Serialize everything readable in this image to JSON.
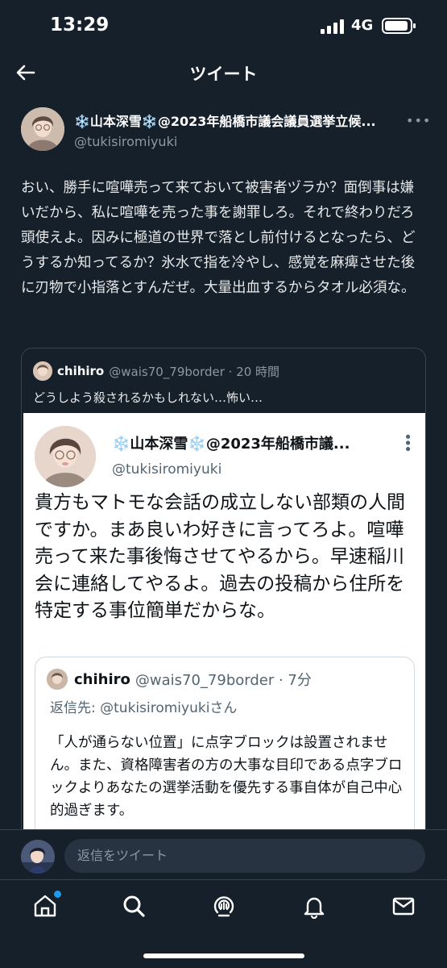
{
  "status_bar": {
    "time": "13:29",
    "network": "4G"
  },
  "header": {
    "title": "ツイート",
    "back_icon": "arrow-left-icon"
  },
  "tweet": {
    "author_name": "❄️山本深雪❄️@2023年船橋市議会議員選挙立候...",
    "author_handle": "@tukisiromiyuki",
    "more_label": "•••",
    "text": "おい、勝手に喧嘩売って来ておいて被害者ヅラか？面倒事は嫌いだから、私に喧嘩を売った事を謝罪しろ。それで終わりだろ頭使えよ。因みに極道の世界で落とし前付けるとなったら、どうするか知ってるか？氷水で指を冷やし、感覚を麻痺させた後に刃物で小指落とすんだぜ。大量出血するからタオル必須な。"
  },
  "quote": {
    "author_name": "chihiro",
    "author_meta": "@wais70_79border · 20 時間",
    "text": "どうしよう殺されるかもしれない…怖い…",
    "screenshot": {
      "author_name": "❄️山本深雪❄️@2023年船橋市議...",
      "author_handle": "@tukisiromiyuki",
      "more_label": "•••",
      "text": "貴方もマトモな会話の成立しない部類の人間ですか。まあ良いわ好きに言ってろよ。喧嘩売って来た事後悔させてやるから。早速稲川会に連絡してやるよ。過去の投稿から住所を特定する事位簡単だからな。",
      "inner": {
        "author_name": "chihiro",
        "author_meta": "@wais70_79border · 7分",
        "reply_prefix": "返信先: ",
        "reply_mention": "@tukisiromiyukiさん",
        "text": "「人が通らない位置」に点字ブロックは設置されません。また、資格障害者の方の大事な目印である点字ブロックよりあなたの選挙活動を優先する事自体が自己中心的過ぎます。"
      }
    }
  },
  "reply_bar": {
    "placeholder": "返信をツイート"
  },
  "tabbar": {
    "icons": [
      "home-icon",
      "search-icon",
      "spaces-icon",
      "bell-icon",
      "envelope-icon"
    ],
    "accent": "#1d9bf0"
  },
  "colors": {
    "background": "#15202b",
    "text": "#e7e9ea",
    "secondary": "#8b98a5",
    "border": "#38444d"
  }
}
